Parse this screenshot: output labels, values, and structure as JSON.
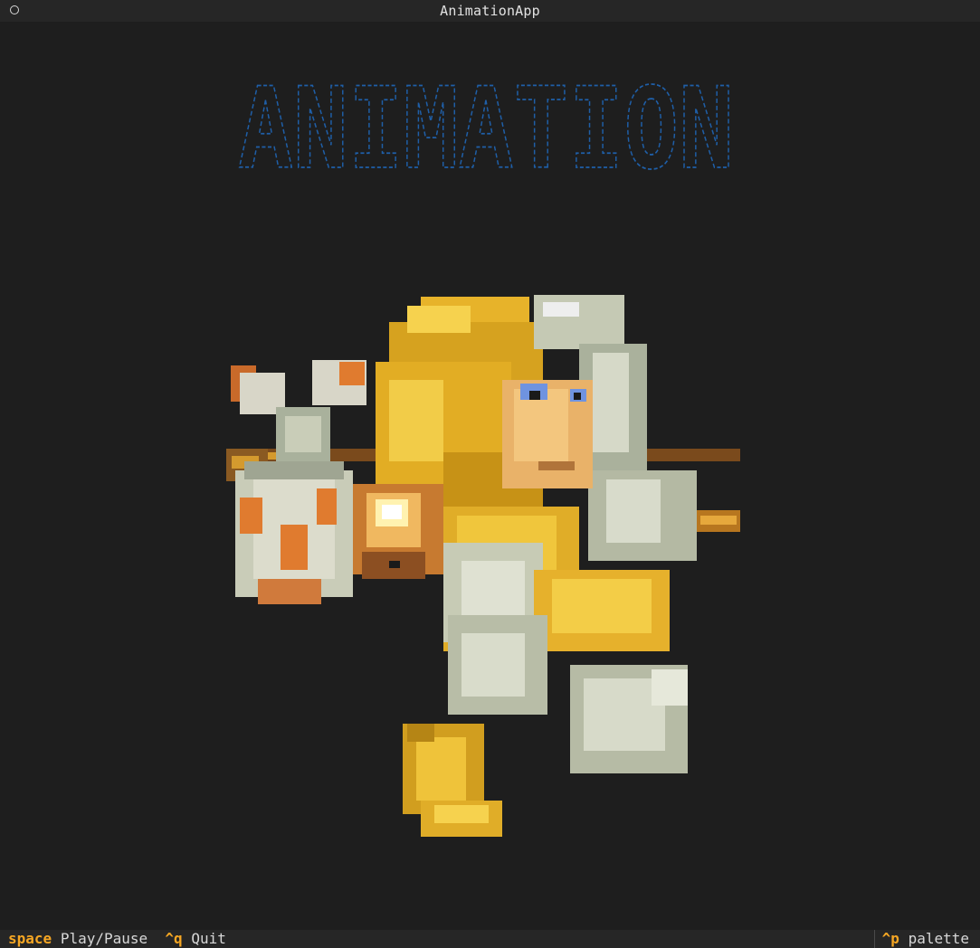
{
  "window": {
    "title": "AnimationApp"
  },
  "banner": {
    "text": "ANIMATION",
    "color": "#1f5fa8"
  },
  "footer": {
    "bindings": [
      {
        "key": "space",
        "label": "Play/Pause"
      },
      {
        "key": "^q",
        "label": "Quit"
      }
    ],
    "palette": {
      "key": "^p",
      "label": "palette"
    }
  },
  "colors": {
    "background": "#1e1e1e",
    "bar": "#262626",
    "key_accent": "#f5a623"
  }
}
